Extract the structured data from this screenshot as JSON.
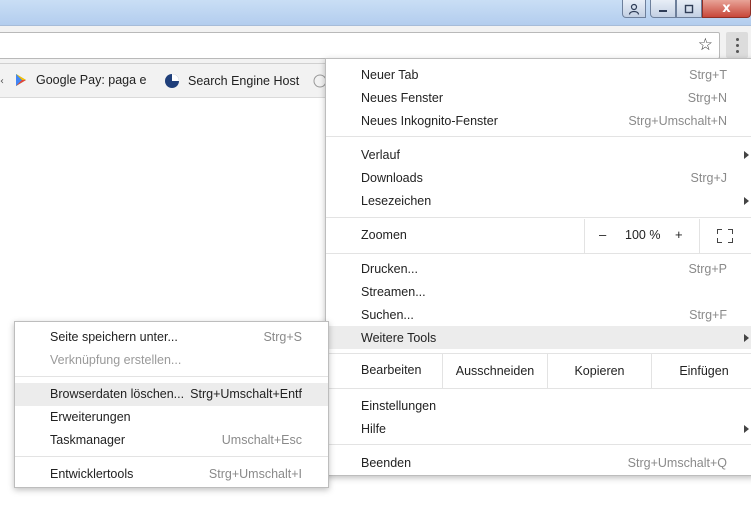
{
  "window": {
    "close_glyph": "x"
  },
  "bookmarks": [
    {
      "label": "Google Pay: paga e",
      "icon": "google-play-icon"
    },
    {
      "label": "Search Engine Host",
      "icon": "search-engine-host-icon"
    }
  ],
  "menu": {
    "new_tab": {
      "label": "Neuer Tab",
      "shortcut": "Strg+T"
    },
    "new_window": {
      "label": "Neues Fenster",
      "shortcut": "Strg+N"
    },
    "incognito": {
      "label": "Neues Inkognito-Fenster",
      "shortcut": "Strg+Umschalt+N"
    },
    "history": {
      "label": "Verlauf"
    },
    "downloads": {
      "label": "Downloads",
      "shortcut": "Strg+J"
    },
    "bookmarks": {
      "label": "Lesezeichen"
    },
    "zoom": {
      "label": "Zoomen",
      "minus": "–",
      "value": "100 %",
      "plus": "+"
    },
    "print": {
      "label": "Drucken...",
      "shortcut": "Strg+P"
    },
    "cast": {
      "label": "Streamen..."
    },
    "find": {
      "label": "Suchen...",
      "shortcut": "Strg+F"
    },
    "more_tools": {
      "label": "Weitere Tools"
    },
    "edit": {
      "label": "Bearbeiten",
      "cut": "Ausschneiden",
      "copy": "Kopieren",
      "paste": "Einfügen"
    },
    "settings": {
      "label": "Einstellungen"
    },
    "help": {
      "label": "Hilfe"
    },
    "exit": {
      "label": "Beenden",
      "shortcut": "Strg+Umschalt+Q"
    }
  },
  "submenu": {
    "save_page": {
      "label": "Seite speichern unter...",
      "shortcut": "Strg+S"
    },
    "create_shortcut": {
      "label": "Verknüpfung erstellen..."
    },
    "clear_data": {
      "label": "Browserdaten löschen...",
      "shortcut": "Strg+Umschalt+Entf"
    },
    "extensions": {
      "label": "Erweiterungen"
    },
    "task_manager": {
      "label": "Taskmanager",
      "shortcut": "Umschalt+Esc"
    },
    "dev_tools": {
      "label": "Entwicklertools",
      "shortcut": "Strg+Umschalt+I"
    }
  }
}
